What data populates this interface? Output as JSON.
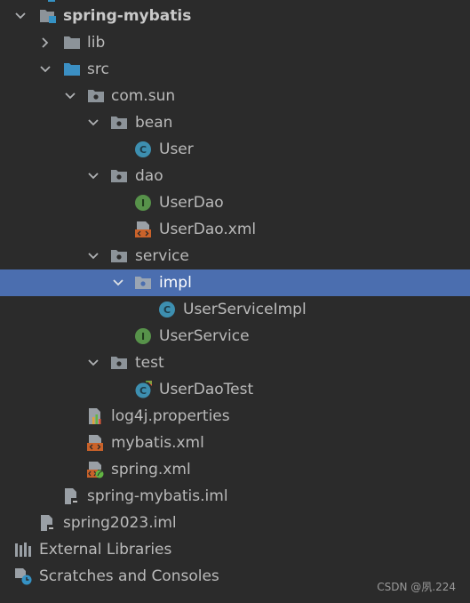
{
  "project_tree": {
    "root": "spring-mybatis",
    "lib": "lib",
    "src": "src",
    "package": "com.sun",
    "bean": "bean",
    "user": "User",
    "dao": "dao",
    "userdao": "UserDao",
    "userdao_xml": "UserDao.xml",
    "service": "service",
    "impl": "impl",
    "userserviceimpl": "UserServiceImpl",
    "userservice": "UserService",
    "test": "test",
    "userdaotest": "UserDaoTest",
    "log4j": "log4j.properties",
    "mybatis_xml": "mybatis.xml",
    "spring_xml": "spring.xml",
    "module_iml": "spring-mybatis.iml",
    "project_iml": "spring2023.iml",
    "external_libraries": "External Libraries",
    "scratches": "Scratches and Consoles"
  },
  "watermark": "CSDN @夙.224",
  "colors": {
    "background": "#2b2b2b",
    "selection": "#4b6eaf",
    "class_icon": "#3d8fb0",
    "interface_icon": "#57924a",
    "folder": "#8c9399",
    "xml_icon": "#c9622a"
  }
}
